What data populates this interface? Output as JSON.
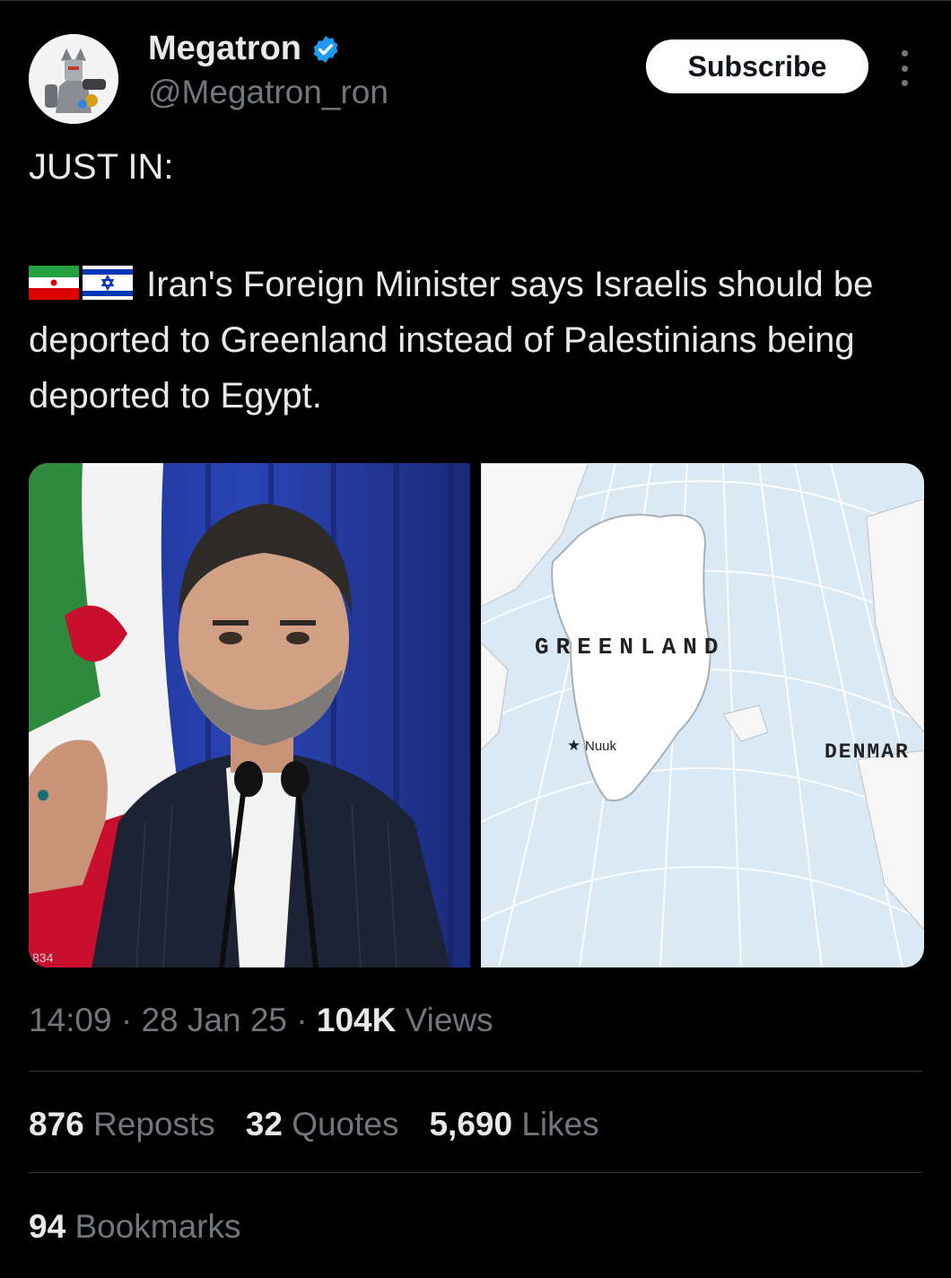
{
  "author": {
    "name": "Megatron",
    "handle": "@Megatron_ron",
    "verified": true,
    "verified_color": "#1d9bf0"
  },
  "subscribe_label": "Subscribe",
  "tweet": {
    "line1": "JUST IN:",
    "body": "Iran's Foreign Minister says Israelis should be deported to Greenland instead of Palestinians being deported to Egypt.",
    "flags": [
      "iran-flag-icon",
      "israel-flag-icon"
    ]
  },
  "media": {
    "photo_watermark": "834",
    "map_labels": {
      "country": "GREENLAND",
      "city": "Nuuk",
      "neighbor": "DENMAR"
    }
  },
  "meta": {
    "time": "14:09",
    "date": "28 Jan 25",
    "views_count": "104K",
    "views_label": "Views"
  },
  "stats": {
    "reposts_count": "876",
    "reposts_label": "Reposts",
    "quotes_count": "32",
    "quotes_label": "Quotes",
    "likes_count": "5,690",
    "likes_label": "Likes",
    "bookmarks_count": "94",
    "bookmarks_label": "Bookmarks"
  }
}
